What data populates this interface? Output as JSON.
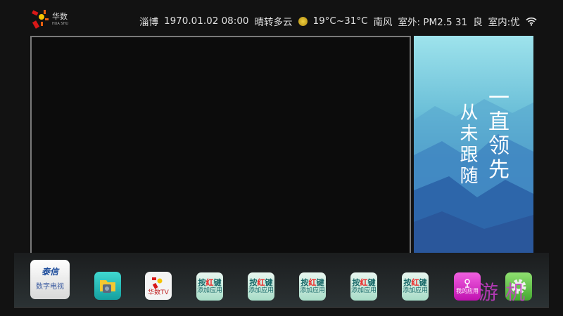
{
  "logo": {
    "name": "华数",
    "sub": "HUA SHU"
  },
  "status": {
    "city": "淄博",
    "datetime": "1970.01.02 08:00",
    "weather": "晴转多云",
    "temp": "19°C~31°C",
    "wind": "南风",
    "outdoor": "室外: PM2.5 31",
    "quality": "良",
    "indoor": "室内:优"
  },
  "poster": {
    "line1": "一直领先",
    "line2": "从未跟随"
  },
  "dock": {
    "tv": {
      "brand": "泰信",
      "label": "数字电视"
    },
    "huashu": {
      "label": "华数TV"
    },
    "add_slots": [
      {
        "l1a": "按",
        "l1b": "红",
        "l1c": "键",
        "l2": "添加应用"
      },
      {
        "l1a": "按",
        "l1b": "红",
        "l1c": "键",
        "l2": "添加应用"
      },
      {
        "l1a": "按",
        "l1b": "红",
        "l1c": "键",
        "l2": "添加应用"
      },
      {
        "l1a": "按",
        "l1b": "红",
        "l1c": "键",
        "l2": "添加应用"
      },
      {
        "l1a": "按",
        "l1b": "红",
        "l1c": "键",
        "l2": "添加应用"
      }
    ],
    "myapps": {
      "label": "我的应用"
    }
  },
  "watermark": "游机"
}
